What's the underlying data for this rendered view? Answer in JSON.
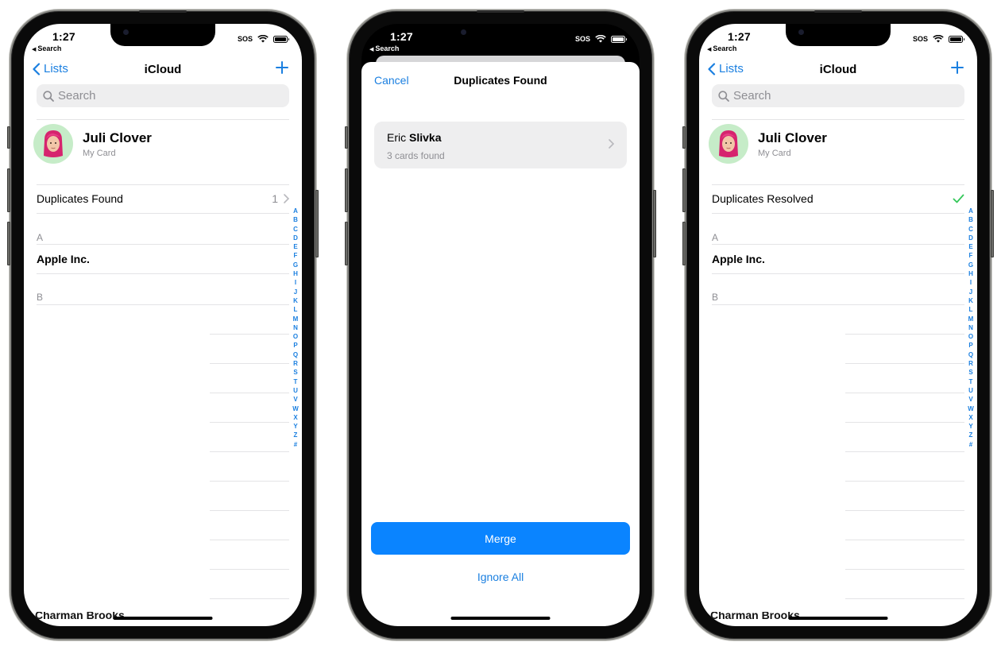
{
  "status_bar": {
    "time": "1:27",
    "back_app": "Search",
    "carrier": "SOS",
    "wifi_icon": "wifi-icon",
    "battery_icon": "battery-icon"
  },
  "contacts_list": {
    "nav": {
      "back_label": "Lists",
      "title": "iCloud",
      "add_icon": "plus-icon"
    },
    "search_placeholder": "Search",
    "my_card": {
      "name": "Juli Clover",
      "subtitle": "My Card",
      "avatar_bg": "#c6ecc8"
    },
    "sections": [
      {
        "header": "A",
        "contacts": [
          "Apple Inc."
        ]
      },
      {
        "header": "B",
        "contacts": []
      }
    ],
    "peek_contact": "Charman Brooks",
    "index_letters": [
      "A",
      "B",
      "C",
      "D",
      "E",
      "F",
      "G",
      "H",
      "I",
      "J",
      "K",
      "L",
      "M",
      "N",
      "O",
      "P",
      "Q",
      "R",
      "S",
      "T",
      "U",
      "V",
      "W",
      "X",
      "Y",
      "Z",
      "#"
    ]
  },
  "screens": [
    {
      "id": "before",
      "duplicates_row": {
        "label": "Duplicates Found",
        "count": "1"
      }
    },
    {
      "id": "duplicates-sheet",
      "sheet": {
        "cancel_label": "Cancel",
        "title": "Duplicates Found",
        "duplicate": {
          "first_name": "Eric",
          "last_name": "Slivka",
          "count_text": "3 cards found"
        },
        "merge_label": "Merge",
        "ignore_label": "Ignore All"
      }
    },
    {
      "id": "after",
      "duplicates_row": {
        "label": "Duplicates Resolved",
        "status_icon": "checkmark-icon"
      }
    }
  ],
  "colors": {
    "accent": "#1a7fe0",
    "merge_button": "#0a84ff",
    "success": "#34c759",
    "secondary_text": "#8e8e93",
    "search_bg": "#eeeeef"
  }
}
